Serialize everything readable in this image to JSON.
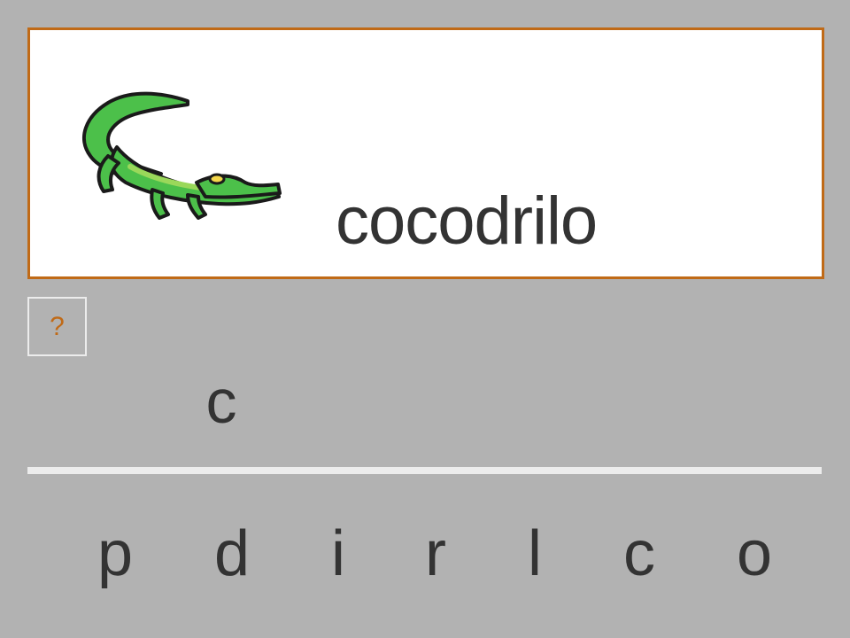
{
  "card": {
    "word": "cocodrilo",
    "picture_icon": "crocodile-icon",
    "border_color": "#c06a17"
  },
  "hint": {
    "label": "?",
    "color": "#c06a17"
  },
  "answer": {
    "letters": [
      "c"
    ]
  },
  "letter_tiles": [
    "p",
    "d",
    "i",
    "r",
    "l",
    "c",
    "o"
  ],
  "colors": {
    "background": "#b2b2b2",
    "text": "#333333",
    "divider": "#ececec"
  }
}
